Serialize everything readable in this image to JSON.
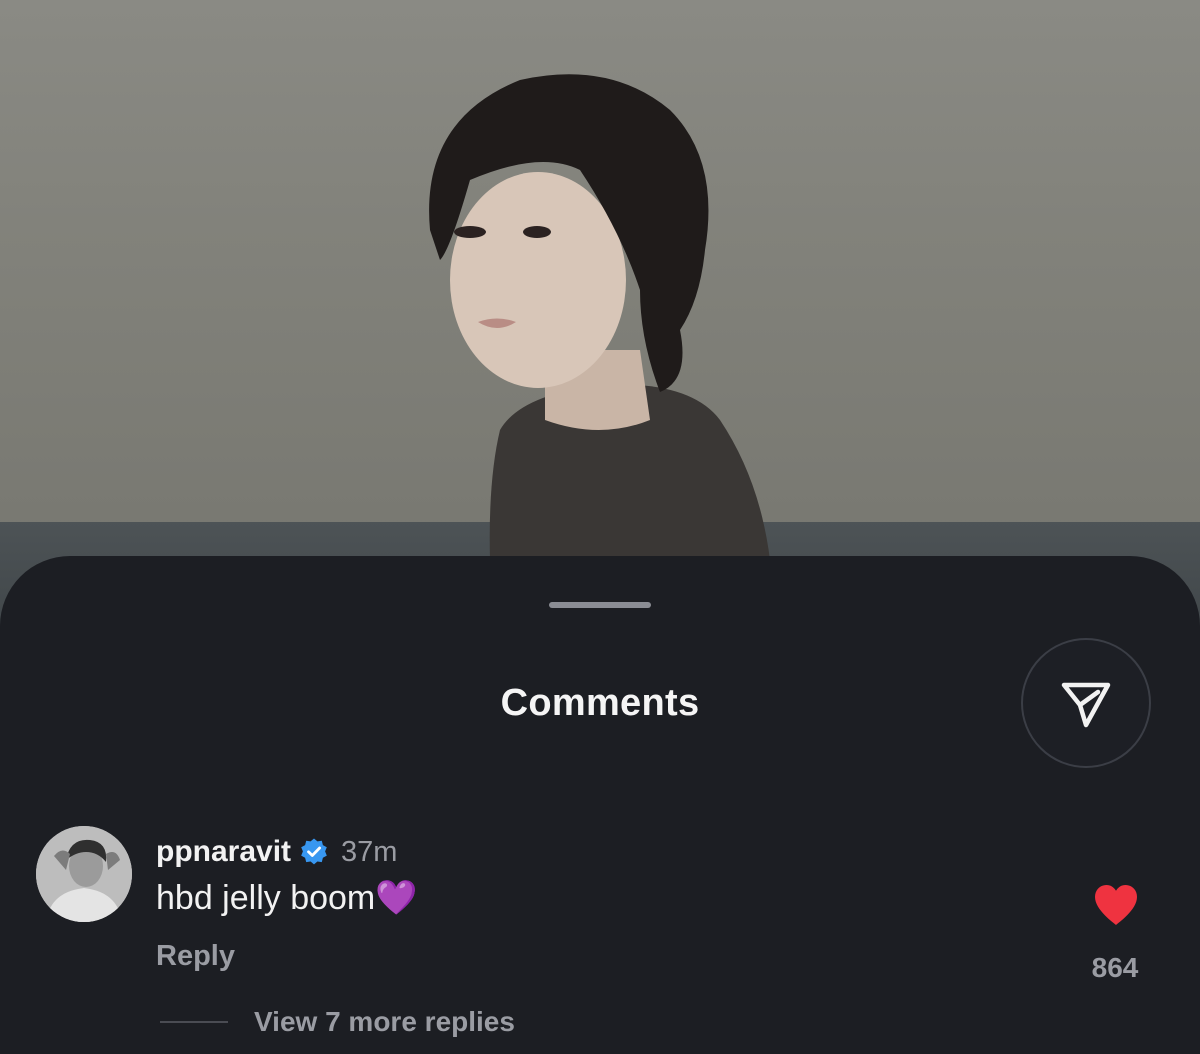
{
  "post": {
    "image_description_icon": "portrait-photo"
  },
  "sheet": {
    "title": "Comments",
    "share_icon": "send-icon"
  },
  "comment": {
    "username": "ppnaravit",
    "verified_icon": "verified-badge-icon",
    "timestamp": "37m",
    "text": "hbd jelly boom💜",
    "reply_label": "Reply",
    "like_icon": "heart-filled-icon",
    "like_count": "864",
    "view_replies_label": "View 7 more replies"
  },
  "colors": {
    "sheet_background": "#1c1e23",
    "heart": "#ef3340",
    "verified": "#3897f0",
    "secondary_text": "#9a9ca3"
  }
}
